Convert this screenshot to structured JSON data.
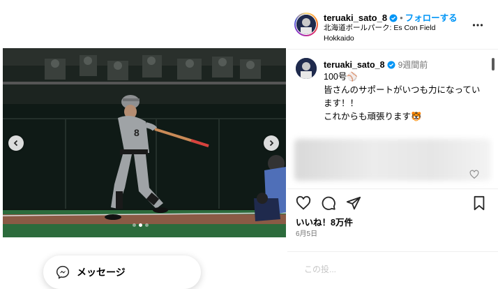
{
  "post": {
    "username": "teruaki_sato_8",
    "follow_label": "フォローする",
    "separator": "•",
    "location": "北海道ボールパーク: Es Con Field Hokkaido"
  },
  "caption": {
    "username": "teruaki_sato_8",
    "time": "9週間前",
    "text": "100号⚾\n皆さんのサポートがいつも力になっています！！\nこれからも頑張ります🐯"
  },
  "stats": {
    "likes": "いいね！8万件",
    "date": "6月5日"
  },
  "comment_box": {
    "placeholder": "この投..."
  },
  "message_button": {
    "label": "メッセージ"
  },
  "carousel": {
    "slides": 3,
    "active": 2
  },
  "colors": {
    "accent": "#0095f6",
    "muted": "#737373"
  },
  "icons": {
    "prev": "chevron-left-icon",
    "next": "chevron-right-icon",
    "more": "more-horizontal-icon",
    "like": "heart-icon",
    "comment": "comment-icon",
    "share": "send-icon",
    "save": "bookmark-icon",
    "message": "messenger-icon",
    "verified": "verified-badge-icon"
  }
}
